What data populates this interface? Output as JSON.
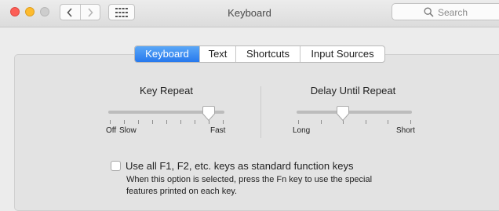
{
  "window": {
    "title": "Keyboard"
  },
  "toolbar": {
    "search_placeholder": "Search"
  },
  "tabs": [
    {
      "label": "Keyboard",
      "active": true
    },
    {
      "label": "Text",
      "active": false
    },
    {
      "label": "Shortcuts",
      "active": false
    },
    {
      "label": "Input Sources",
      "active": false
    }
  ],
  "key_repeat": {
    "title": "Key Repeat",
    "min_label": "Off",
    "low_label": "Slow",
    "max_label": "Fast",
    "position_fraction": 0.875
  },
  "delay_until_repeat": {
    "title": "Delay Until Repeat",
    "min_label": "Long",
    "max_label": "Short",
    "position_fraction": 0.4
  },
  "function_keys": {
    "checked": false,
    "label": "Use all F1, F2, etc. keys as standard function keys",
    "help_line1": "When this option is selected, press the Fn key to use the special",
    "help_line2": "features printed on each key."
  },
  "colors": {
    "accent": "#2f86f2",
    "close": "#fc5f57",
    "minimize": "#fdbb2e"
  }
}
